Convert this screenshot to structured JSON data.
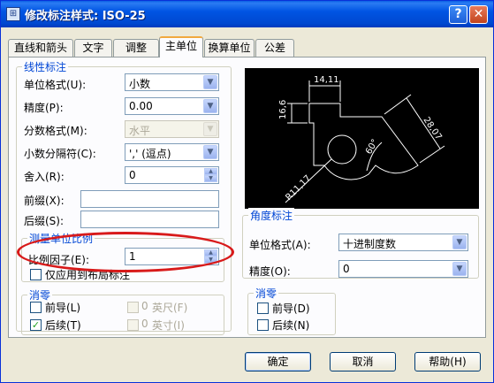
{
  "title": "修改标注样式: ISO-25",
  "titlebar": {
    "help": "?",
    "close": "✕"
  },
  "tabs": [
    "直线和箭头",
    "文字",
    "调整",
    "主单位",
    "换算单位",
    "公差"
  ],
  "linear": {
    "title": "线性标注",
    "unit_format_label": "单位格式(U):",
    "unit_format_value": "小数",
    "precision_label": "精度(P):",
    "precision_value": "0.00",
    "fraction_format_label": "分数格式(M):",
    "fraction_format_value": "水平",
    "decimal_sep_label": "小数分隔符(C):",
    "decimal_sep_value": "','  (逗点)",
    "roundoff_label": "舍入(R):",
    "roundoff_value": "0",
    "prefix_label": "前缀(X):",
    "prefix_value": "",
    "suffix_label": "后缀(S):",
    "suffix_value": ""
  },
  "scale": {
    "title": "测量单位比例",
    "factor_label": "比例因子(E):",
    "factor_value": "1",
    "layout_only_label": "仅应用到布局标注"
  },
  "zero_linear": {
    "title": "消零",
    "leading_label": "前导(L)",
    "trailing_label": "后续(T)",
    "feet_value": "0",
    "feet_label": "英尺(F)",
    "inches_value": "0",
    "inches_label": "英寸(I)"
  },
  "angular": {
    "title": "角度标注",
    "unit_format_label": "单位格式(A):",
    "unit_format_value": "十进制度数",
    "precision_label": "精度(O):",
    "precision_value": "0"
  },
  "zero_angular": {
    "title": "消零",
    "leading_label": "前导(D)",
    "trailing_label": "后续(N)"
  },
  "preview": {
    "dim_top": "14,11",
    "dim_left": "16,6",
    "dim_right": "28,07",
    "dim_angle": "60°",
    "dim_radius": "R11,17"
  },
  "buttons": {
    "ok": "确定",
    "cancel": "取消",
    "help": "帮助(H)"
  },
  "colors": {
    "annotation": "#d81a1a",
    "group_title": "#0046d5",
    "titlebar": "#0054e3"
  }
}
